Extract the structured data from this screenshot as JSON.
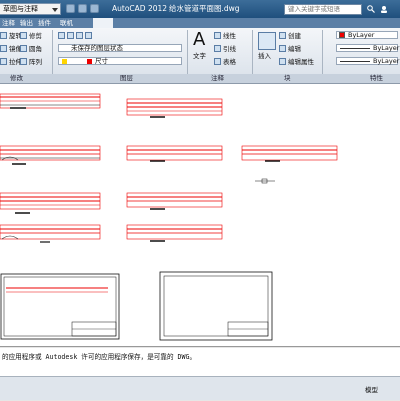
{
  "titlebar": {
    "workspace": "草图与注释",
    "app_name": "AutoCAD 2012",
    "file_name": "给水管道平面图.dwg",
    "search_placeholder": "键入关键字或短语"
  },
  "tabs": [
    "注释",
    "输出",
    "插件",
    "联机"
  ],
  "ribbon": {
    "modify": {
      "rotate": "旋转",
      "trim": "修剪",
      "mirror": "镜像",
      "fillet": "圆角",
      "stretch": "拉伸",
      "array": "阵列"
    },
    "layer_state": "未保存的图层状态",
    "layer_value": "尺寸",
    "text": {
      "label": "文字",
      "linear": "线性",
      "leader": "引线",
      "table": "表格"
    },
    "block": {
      "insert": "插入",
      "create": "创建",
      "edit": "编辑",
      "edit_attr": "编辑属性"
    },
    "props": {
      "color": "ByLayer",
      "linetype": "ByLayer",
      "lineweight": "ByLayer"
    },
    "panel_titles": {
      "modify": "修改",
      "layer": "图层",
      "annotate": "注释",
      "block": "块",
      "props": "特性"
    }
  },
  "command_line": "的应用程序或 Autodesk 许可的应用程序保存，是可靠的 DWG。",
  "status": {
    "model": "模型"
  }
}
